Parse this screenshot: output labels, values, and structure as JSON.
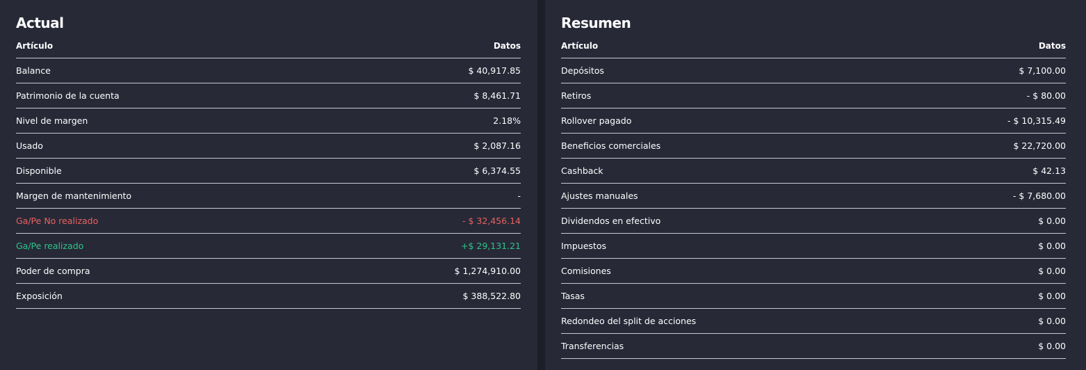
{
  "colors": {
    "page_bg": "#1c1e28",
    "panel_bg": "#272937",
    "text": "#ffffff",
    "divider": "#c9cad0",
    "negative": "#e8625f",
    "positive": "#2ec48a"
  },
  "actual": {
    "title": "Actual",
    "header": {
      "item": "Artículo",
      "data": "Datos"
    },
    "rows": [
      {
        "label": "Balance",
        "value": "$ 40,917.85",
        "tone": ""
      },
      {
        "label": "Patrimonio de la cuenta",
        "value": "$ 8,461.71",
        "tone": ""
      },
      {
        "label": "Nivel de margen",
        "value": "2.18%",
        "tone": ""
      },
      {
        "label": "Usado",
        "value": "$ 2,087.16",
        "tone": ""
      },
      {
        "label": "Disponible",
        "value": "$ 6,374.55",
        "tone": ""
      },
      {
        "label": "Margen de mantenimiento",
        "value": "-",
        "tone": ""
      },
      {
        "label": "Ga/Pe No realizado",
        "value": "- $ 32,456.14",
        "tone": "neg"
      },
      {
        "label": "Ga/Pe realizado",
        "value": "+$ 29,131.21",
        "tone": "pos"
      },
      {
        "label": "Poder de compra",
        "value": "$ 1,274,910.00",
        "tone": ""
      },
      {
        "label": "Exposición",
        "value": "$ 388,522.80",
        "tone": ""
      }
    ]
  },
  "resumen": {
    "title": "Resumen",
    "header": {
      "item": "Artículo",
      "data": "Datos"
    },
    "rows": [
      {
        "label": "Depósitos",
        "value": "$ 7,100.00",
        "tone": ""
      },
      {
        "label": "Retiros",
        "value": "- $ 80.00",
        "tone": ""
      },
      {
        "label": "Rollover pagado",
        "value": "- $ 10,315.49",
        "tone": ""
      },
      {
        "label": "Beneficios comerciales",
        "value": "$ 22,720.00",
        "tone": ""
      },
      {
        "label": "Cashback",
        "value": "$ 42.13",
        "tone": ""
      },
      {
        "label": "Ajustes manuales",
        "value": "- $ 7,680.00",
        "tone": ""
      },
      {
        "label": "Dividendos en efectivo",
        "value": "$ 0.00",
        "tone": ""
      },
      {
        "label": "Impuestos",
        "value": "$ 0.00",
        "tone": ""
      },
      {
        "label": "Comisiones",
        "value": "$ 0.00",
        "tone": ""
      },
      {
        "label": "Tasas",
        "value": "$ 0.00",
        "tone": ""
      },
      {
        "label": "Redondeo del split de acciones",
        "value": "$ 0.00",
        "tone": ""
      },
      {
        "label": "Transferencias",
        "value": "$ 0.00",
        "tone": ""
      }
    ]
  }
}
